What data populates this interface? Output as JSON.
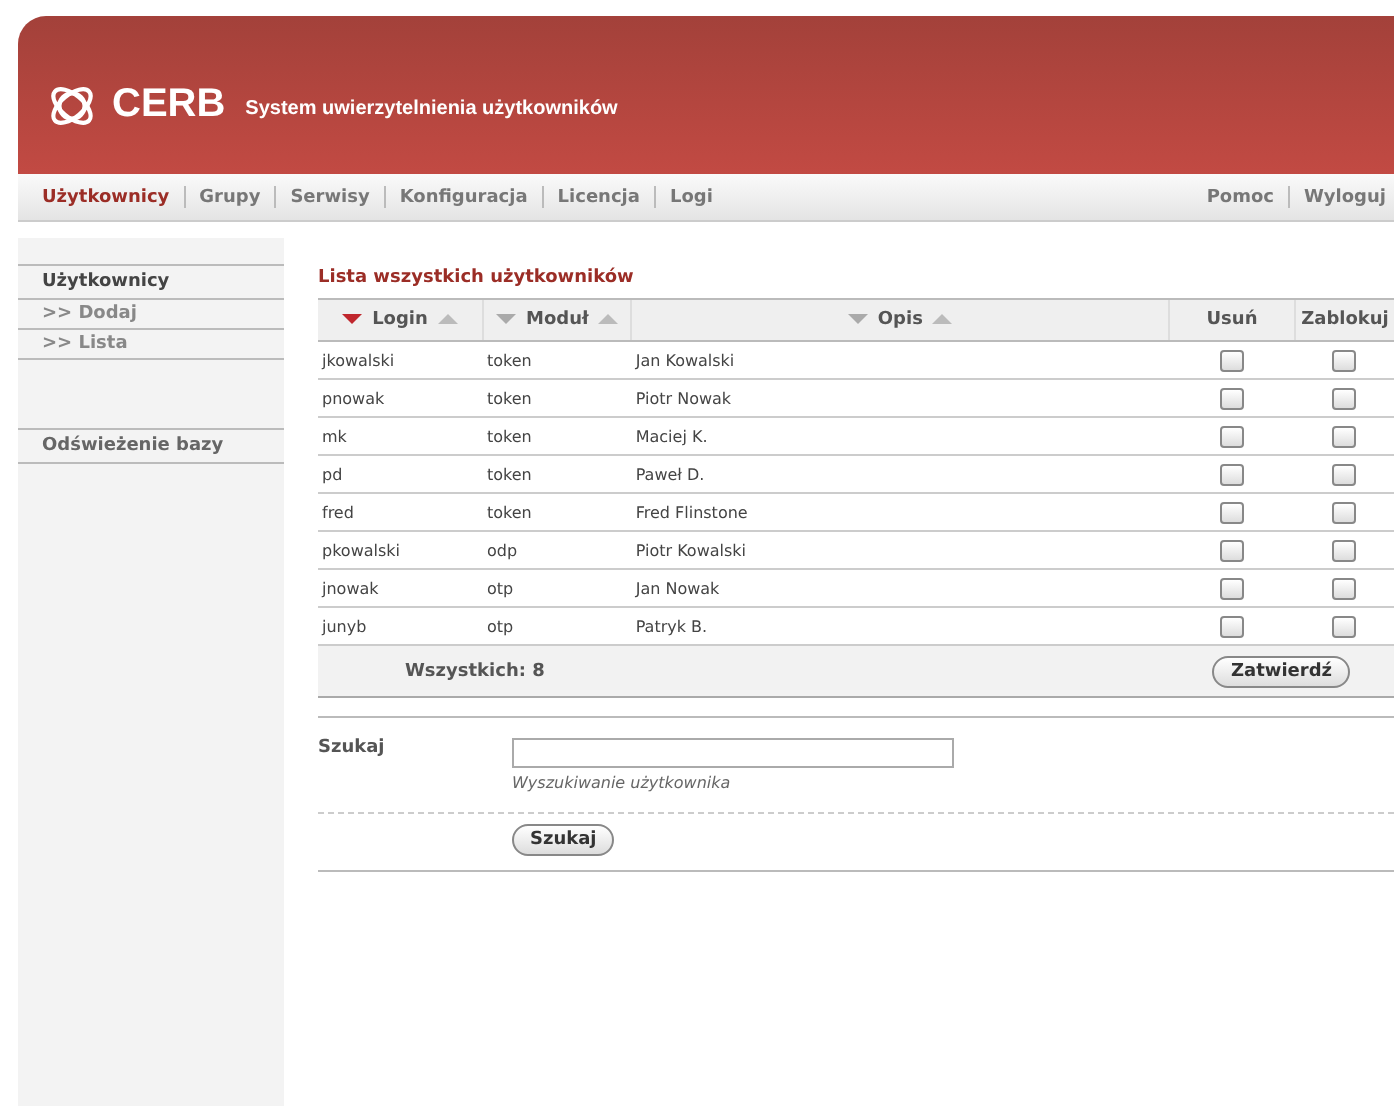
{
  "header": {
    "logo_text": "CERB",
    "subtitle": "System uwierzytelnienia użytkowników"
  },
  "nav": {
    "items": [
      {
        "label": "Użytkownicy",
        "selected": true
      },
      {
        "label": "Grupy",
        "selected": false
      },
      {
        "label": "Serwisy",
        "selected": false
      },
      {
        "label": "Konfiguracja",
        "selected": false
      },
      {
        "label": "Licencja",
        "selected": false
      },
      {
        "label": "Logi",
        "selected": false
      }
    ],
    "right_items": [
      {
        "label": "Pomoc"
      },
      {
        "label": "Wyloguj"
      }
    ]
  },
  "sidebar": {
    "sections": [
      {
        "title": "Użytkownicy",
        "items": [
          ">> Dodaj",
          ">> Lista"
        ]
      },
      {
        "title": "Odświeżenie bazy"
      }
    ]
  },
  "content": {
    "title": "Lista wszystkich użytkowników",
    "columns": [
      {
        "label": "Login",
        "kind": "sortable",
        "selected": true
      },
      {
        "label": "Moduł",
        "kind": "sortable",
        "selected": false
      },
      {
        "label": "Opis",
        "kind": "sortable",
        "selected": false
      },
      {
        "label": "Usuń",
        "kind": "plain"
      },
      {
        "label": "Zablokuj",
        "kind": "plain"
      }
    ],
    "rows": [
      {
        "login": "jkowalski",
        "module": "token",
        "description": "Jan Kowalski",
        "delete": false,
        "block": false
      },
      {
        "login": "pnowak",
        "module": "token",
        "description": "Piotr Nowak",
        "delete": false,
        "block": false
      },
      {
        "login": "mk",
        "module": "token",
        "description": "Maciej K.",
        "delete": false,
        "block": false
      },
      {
        "login": "pd",
        "module": "token",
        "description": "Paweł D.",
        "delete": false,
        "block": false
      },
      {
        "login": "fred",
        "module": "token",
        "description": "Fred Flinstone",
        "delete": false,
        "block": false
      },
      {
        "login": "pkowalski",
        "module": "odp",
        "description": "Piotr Kowalski",
        "delete": false,
        "block": false
      },
      {
        "login": "jnowak",
        "module": "otp",
        "description": "Jan Nowak",
        "delete": false,
        "block": false
      },
      {
        "login": "junyb",
        "module": "otp",
        "description": "Patryk B.",
        "delete": false,
        "block": false
      }
    ],
    "total": "Wszystkich: 8",
    "submit": "Zatwierdź"
  },
  "search": {
    "label": "Szukaj",
    "hint": "Wyszukiwanie użytkownika",
    "button": "Szukaj"
  }
}
